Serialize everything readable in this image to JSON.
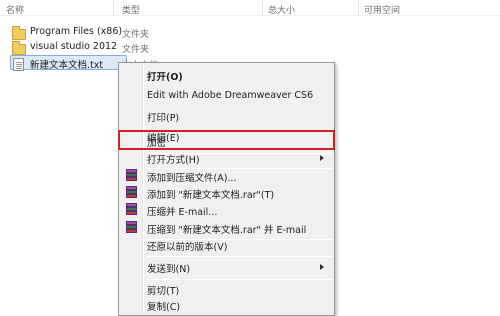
{
  "columns": {
    "name": "名称",
    "type": "类型",
    "size": "总大小",
    "free": "可用空间"
  },
  "files": [
    {
      "name": "Program Files (x86)",
      "type": "文件夹",
      "icon": "folder-icon"
    },
    {
      "name": "visual studio 2012",
      "type": "文件夹",
      "icon": "folder-icon"
    },
    {
      "name": "新建文本文档.txt",
      "type": "文本文档",
      "icon": "text-file-icon"
    }
  ],
  "menu": {
    "open": "打开(O)",
    "edit_dreamweaver": "Edit with Adobe Dreamweaver CS6",
    "print": "打印(P)",
    "edit": "编辑(E)",
    "encrypt": "加密",
    "open_with": "打开方式(H)",
    "add_to_archive": "添加到压缩文件(A)...",
    "add_to_rar": "添加到 \"新建文本文档.rar\"(T)",
    "compress_email": "压缩并 E-mail...",
    "compress_rar_email": "压缩到 \"新建文本文档.rar\" 并 E-mail",
    "restore_previous": "还原以前的版本(V)",
    "send_to": "发送到(N)",
    "cut": "剪切(T)",
    "copy": "复制(C)"
  },
  "colors": {
    "highlight_border": "#d42020",
    "selection_fill": "#dbe9f8",
    "selection_border": "#84acdd"
  }
}
